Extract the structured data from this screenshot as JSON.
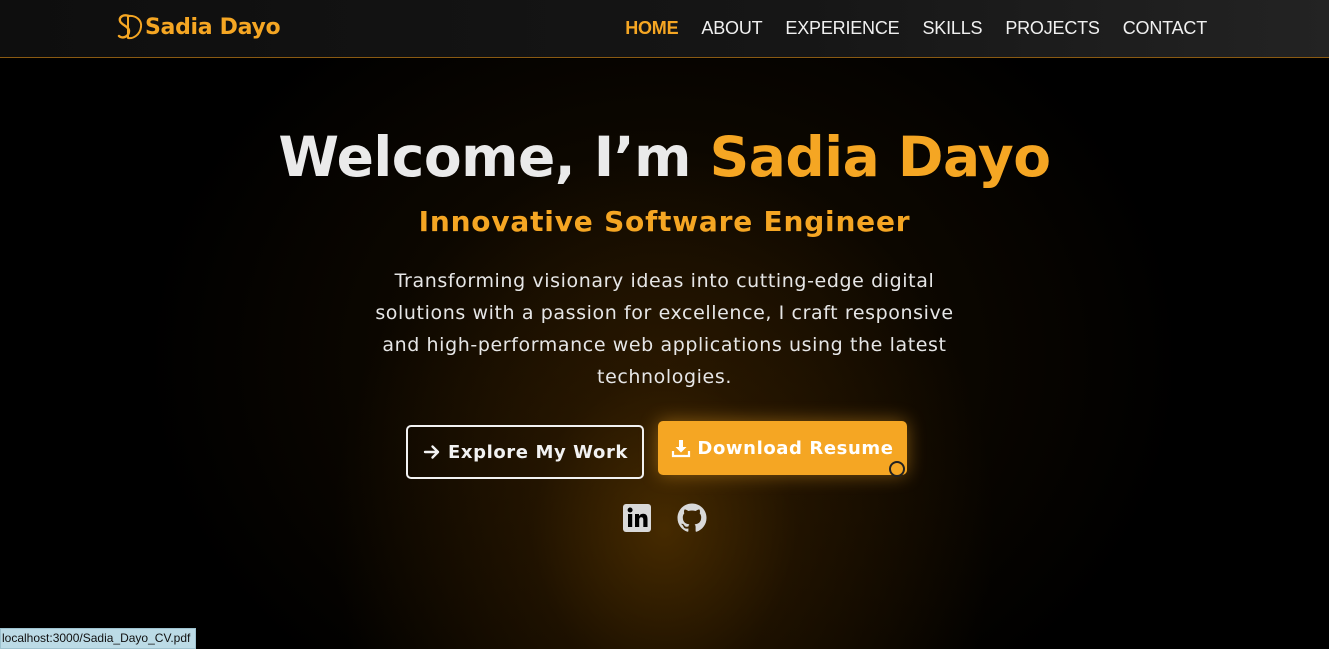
{
  "brand": {
    "logo_icon": "sd-monogram-icon",
    "name": "Sadia Dayo"
  },
  "nav": {
    "items": [
      {
        "label": "HOME",
        "active": true
      },
      {
        "label": "ABOUT",
        "active": false
      },
      {
        "label": "EXPERIENCE",
        "active": false
      },
      {
        "label": "SKILLS",
        "active": false
      },
      {
        "label": "PROJECTS",
        "active": false
      },
      {
        "label": "CONTACT",
        "active": false
      }
    ]
  },
  "hero": {
    "title_prefix": "Welcome, I’m",
    "title_name": "Sadia Dayo",
    "subtitle": "Innovative Software Engineer",
    "description": "Transforming visionary ideas into cutting-edge digital solutions with a passion for excellence, I craft responsive and high-performance web applications using the latest technologies.",
    "primary_button": {
      "label": "Explore My Work",
      "icon": "arrow-right-icon"
    },
    "secondary_button": {
      "label": "Download Resume",
      "icon": "download-icon"
    }
  },
  "social": [
    {
      "name": "linkedin-icon"
    },
    {
      "name": "github-icon"
    }
  ],
  "status_bar": {
    "url": "localhost:3000/Sadia_Dayo_CV.pdf"
  },
  "colors": {
    "accent": "#f5a623",
    "background": "#000000",
    "text": "#eaeaea"
  }
}
